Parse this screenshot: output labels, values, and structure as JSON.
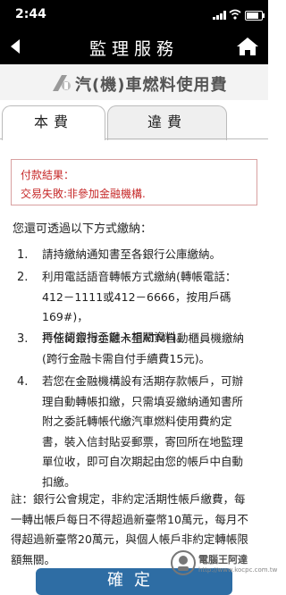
{
  "status_bar": {
    "time": "2:44"
  },
  "nav": {
    "title": "監理服務"
  },
  "banner": {
    "text": "汽(機)車燃料使用費"
  },
  "tabs": [
    {
      "label": "本費"
    },
    {
      "label": "違費"
    }
  ],
  "result": {
    "title": "付款結果：",
    "message": "交易失敗:非參加金融機構."
  },
  "intro": "您還可透過以下方式繳納：",
  "methods": [
    {
      "num": "1.",
      "lines": [
        "請持繳納通知書至各銀行公庫繳納。"
      ]
    },
    {
      "num": "2.",
      "lines": [
        "利用電話語音轉帳方式繳納(轉帳電話：",
        "412－1111或412－6666，按用戶碼169#)，",
        "再依語音指示鍵入相關資料。"
      ]
    },
    {
      "num": "3.",
      "lines": [
        "持任何銀行金融卡至ATM自動櫃員機繳納",
        "(跨行金融卡需自付手續費15元)。"
      ]
    },
    {
      "num": "4.",
      "lines": [
        "若您在金融機構設有活期存款帳戶，可辦",
        "理自動轉帳扣繳，只需填妥繳納通知書所",
        "附之委託轉帳代繳汽車燃料使用費約定",
        "書，裝入信封貼妥郵票，寄回所在地監理",
        "單位收，即可自次期起由您的帳戶中自動",
        "扣繳。"
      ]
    }
  ],
  "note": {
    "lines": [
      "註：銀行公會規定，非約定活期性帳戶繳費，每",
      "一轉出帳戶每日不得超過新臺幣10萬元，每月不",
      "得超過新臺幣20萬元，與個人帳戶非約定轉帳限",
      "額無關。"
    ]
  },
  "submit_label": "確定",
  "watermark": {
    "text": "電腦王阿達",
    "url": "http://www.kocpc.com.tw"
  },
  "colors": {
    "bar": "#000000",
    "error": "#c62828",
    "button": "#2e6da4"
  }
}
